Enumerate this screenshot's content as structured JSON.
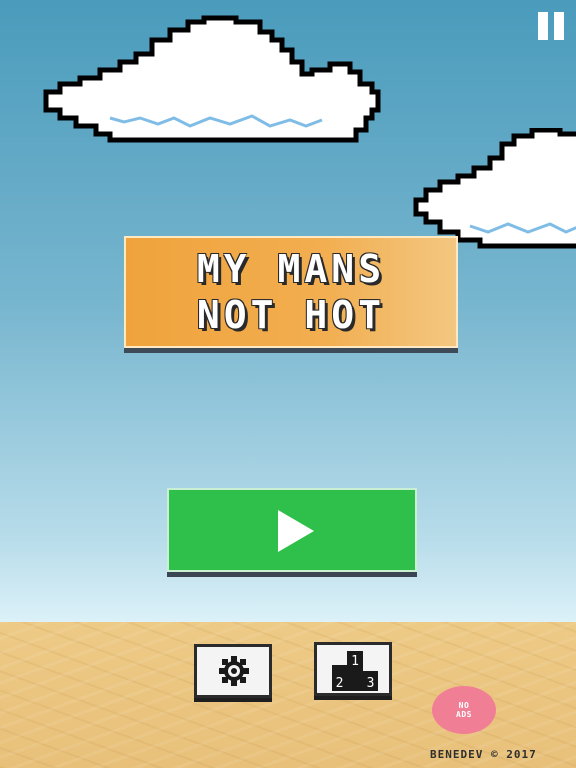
{
  "game": {
    "title_line1": "MY MANS",
    "title_line2": "NOT HOT"
  },
  "controls": {
    "play_icon": "play-icon",
    "settings_icon": "gear-icon",
    "leaderboard_icon": "podium-icon",
    "leaderboard_ranks": [
      "1",
      "2",
      "3"
    ],
    "pause_icon": "pause-icon"
  },
  "no_ads": {
    "line1": "NO",
    "line2": "ADS"
  },
  "footer": {
    "credit": "BENEDEV © 2017"
  },
  "colors": {
    "sky_top": "#4a9bbc",
    "sky_bottom": "#dcf1f8",
    "sand": "#e8c07a",
    "title_orange": "#f0a33c",
    "play_green": "#2fbf4b",
    "no_ads_pink": "#f07f95"
  }
}
